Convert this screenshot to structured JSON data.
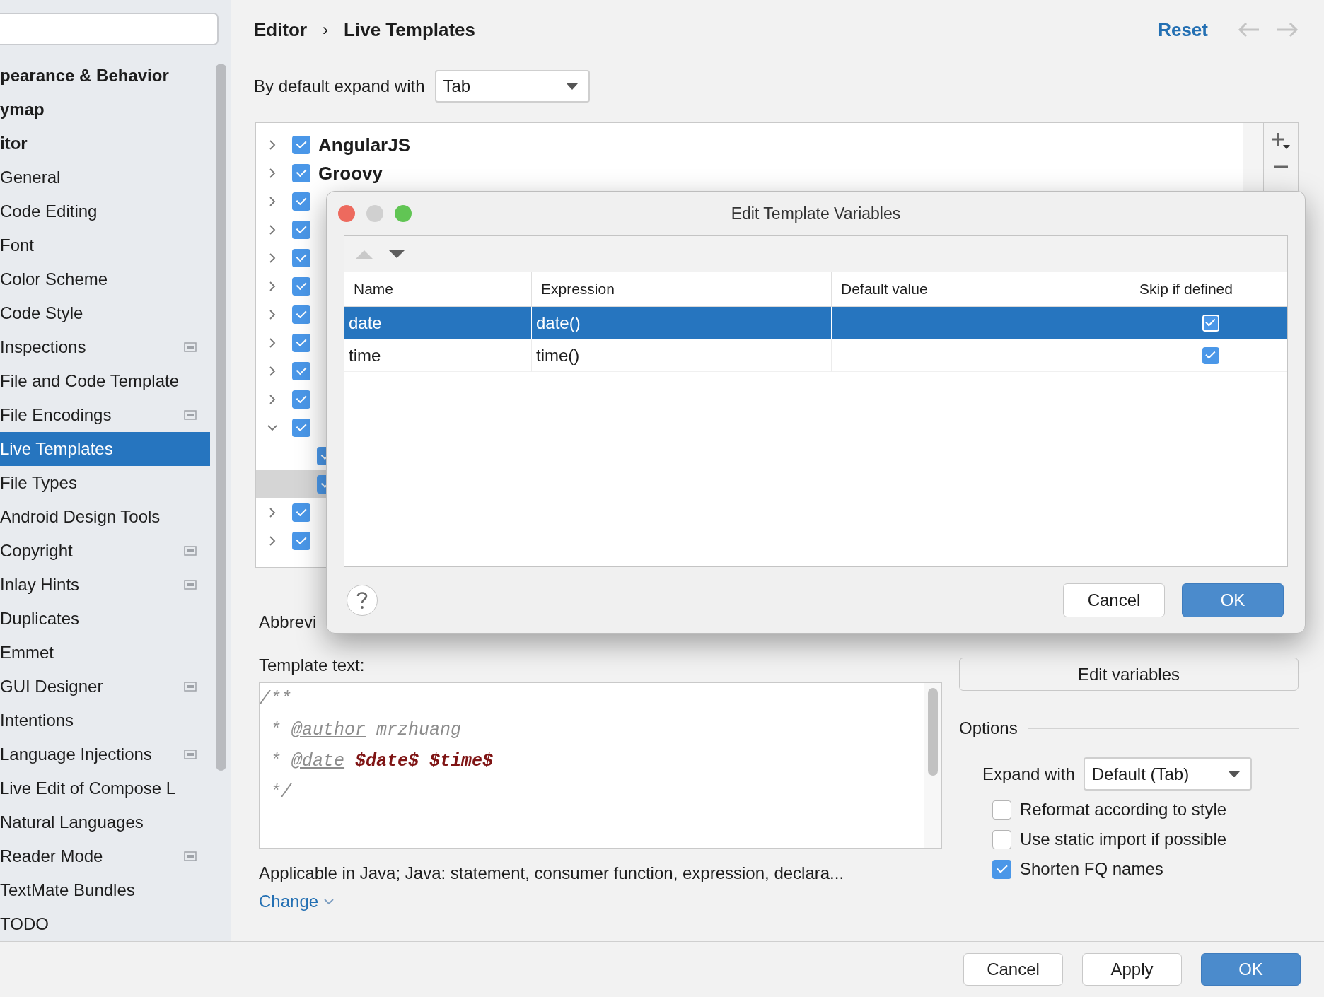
{
  "sidebar": {
    "items": [
      {
        "label": "pearance & Behavior",
        "selected": false,
        "icon": false
      },
      {
        "label": "ymap",
        "selected": false,
        "icon": false
      },
      {
        "label": "itor",
        "selected": false,
        "icon": false,
        "children": [
          {
            "label": "General",
            "selected": false,
            "icon": false
          },
          {
            "label": "Code Editing",
            "selected": false,
            "icon": false
          },
          {
            "label": "Font",
            "selected": false,
            "icon": false
          },
          {
            "label": "Color Scheme",
            "selected": false,
            "icon": false
          },
          {
            "label": "Code Style",
            "selected": false,
            "icon": false
          },
          {
            "label": "Inspections",
            "selected": false,
            "icon": true
          },
          {
            "label": "File and Code Template",
            "selected": false,
            "icon": false
          },
          {
            "label": "File Encodings",
            "selected": false,
            "icon": true
          },
          {
            "label": "Live Templates",
            "selected": true,
            "icon": false
          },
          {
            "label": "File Types",
            "selected": false,
            "icon": false
          },
          {
            "label": "Android Design Tools",
            "selected": false,
            "icon": false
          },
          {
            "label": "Copyright",
            "selected": false,
            "icon": true
          },
          {
            "label": "Inlay Hints",
            "selected": false,
            "icon": true
          },
          {
            "label": "Duplicates",
            "selected": false,
            "icon": false
          },
          {
            "label": "Emmet",
            "selected": false,
            "icon": false
          },
          {
            "label": "GUI Designer",
            "selected": false,
            "icon": true
          },
          {
            "label": "Intentions",
            "selected": false,
            "icon": false
          },
          {
            "label": "Language Injections",
            "selected": false,
            "icon": true
          },
          {
            "label": "Live Edit of Compose L",
            "selected": false,
            "icon": false
          },
          {
            "label": "Natural Languages",
            "selected": false,
            "icon": false
          },
          {
            "label": "Reader Mode",
            "selected": false,
            "icon": true
          },
          {
            "label": "TextMate Bundles",
            "selected": false,
            "icon": false
          },
          {
            "label": "TODO",
            "selected": false,
            "icon": false
          }
        ]
      }
    ]
  },
  "breadcrumb": {
    "items": [
      "Editor",
      "Live Templates"
    ],
    "separator": "›"
  },
  "header_actions": {
    "reset": "Reset",
    "back_disabled": true,
    "forward_disabled": true
  },
  "expand_default": {
    "label": "By default expand with",
    "value": "Tab"
  },
  "template_groups": [
    {
      "label": "AngularJS",
      "checked": true,
      "expanded": false,
      "selected": false
    },
    {
      "label": "Groovy",
      "checked": true,
      "expanded": false,
      "selected": false
    },
    {
      "checked": true,
      "expanded": false,
      "selected": false
    },
    {
      "checked": true,
      "expanded": false,
      "selected": false
    },
    {
      "checked": true,
      "expanded": false,
      "selected": false
    },
    {
      "checked": true,
      "expanded": false,
      "selected": false
    },
    {
      "checked": true,
      "expanded": false,
      "selected": false
    },
    {
      "checked": true,
      "expanded": false,
      "selected": false
    },
    {
      "checked": true,
      "expanded": false,
      "selected": false
    },
    {
      "checked": true,
      "expanded": false,
      "selected": false
    },
    {
      "checked": true,
      "expanded": true,
      "selected": false,
      "children": [
        {
          "checked": true,
          "selected": false
        },
        {
          "checked": true,
          "selected": true
        }
      ]
    },
    {
      "checked": true,
      "expanded": false,
      "selected": false
    },
    {
      "checked": true,
      "expanded": false,
      "selected": false
    }
  ],
  "abbreviation_label": "Abbrevi",
  "template_text": {
    "label": "Template text:",
    "lines": [
      [
        {
          "kind": "comment",
          "text": "/**"
        }
      ],
      [
        {
          "kind": "comment",
          "text": " * "
        },
        {
          "kind": "tag",
          "text": "@author"
        },
        {
          "kind": "comment",
          "text": " mrzhuang"
        }
      ],
      [
        {
          "kind": "comment",
          "text": " * "
        },
        {
          "kind": "tag",
          "text": "@date"
        },
        {
          "kind": "variable",
          "text": " $date$ $time$"
        }
      ],
      [
        {
          "kind": "comment",
          "text": " */"
        }
      ]
    ]
  },
  "applicable": "Applicable in Java; Java: statement, consumer function, expression, declara...",
  "change_link": "Change",
  "edit_variables_button": "Edit variables",
  "options": {
    "title": "Options",
    "expand_with": {
      "label": "Expand with",
      "value": "Default (Tab)"
    },
    "checkboxes": [
      {
        "label": "Reformat according to style",
        "checked": false
      },
      {
        "label": "Use static import if possible",
        "checked": false
      },
      {
        "label": "Shorten FQ names",
        "checked": true
      }
    ]
  },
  "footer_buttons": [
    {
      "label": "Cancel",
      "primary": false
    },
    {
      "label": "Apply",
      "primary": false
    },
    {
      "label": "OK",
      "primary": true
    }
  ],
  "dialog": {
    "title": "Edit Template Variables",
    "move_up_disabled": true,
    "move_down_disabled": false,
    "columns": [
      "Name",
      "Expression",
      "Default value",
      "Skip if defined"
    ],
    "rows": [
      {
        "name": "date",
        "expression": "date()",
        "skip_if_defined": true,
        "selected": true
      },
      {
        "name": "time",
        "expression": "time()",
        "skip_if_defined": true,
        "selected": false
      }
    ],
    "buttons": [
      {
        "label": "Cancel",
        "primary": false
      },
      {
        "label": "OK",
        "primary": true
      }
    ]
  }
}
